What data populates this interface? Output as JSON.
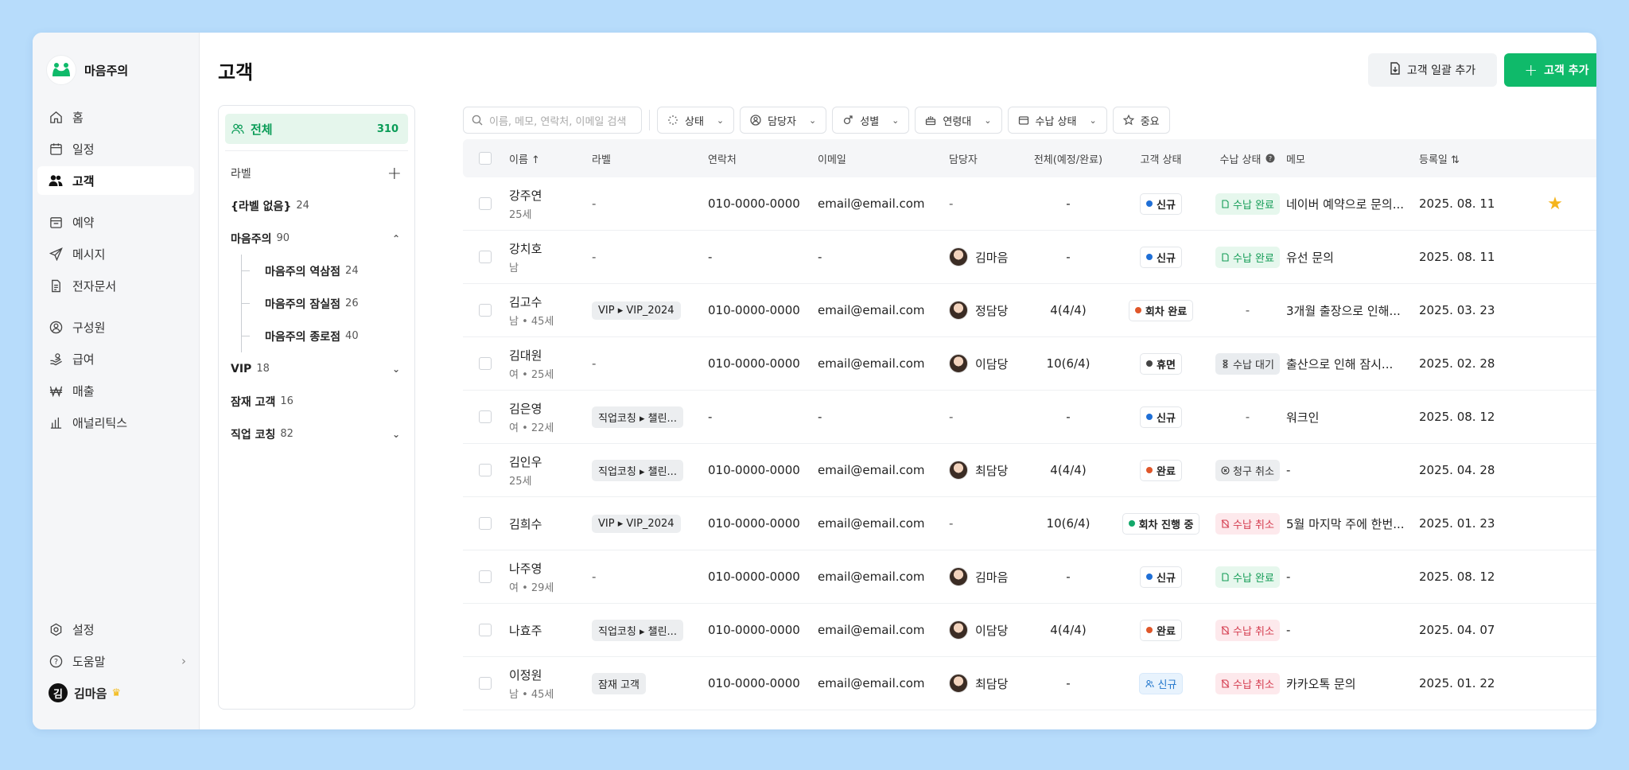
{
  "app": {
    "name": "마음주의"
  },
  "sidebar": {
    "items": [
      {
        "label": "홈",
        "icon": "home-icon"
      },
      {
        "label": "일정",
        "icon": "calendar-icon"
      },
      {
        "label": "고객",
        "icon": "users-icon",
        "active": true
      },
      {
        "label": "예약",
        "icon": "reservation-icon"
      },
      {
        "label": "메시지",
        "icon": "send-icon"
      },
      {
        "label": "전자문서",
        "icon": "document-icon"
      },
      {
        "label": "구성원",
        "icon": "member-icon"
      },
      {
        "label": "급여",
        "icon": "salary-icon"
      },
      {
        "label": "매출",
        "icon": "won-icon"
      },
      {
        "label": "애널리틱스",
        "icon": "chart-icon"
      }
    ],
    "bottom": {
      "settings": "설정",
      "help": "도움말",
      "user": "김마음",
      "user_initial": "김"
    }
  },
  "page": {
    "title": "고객",
    "bulk_add": "고객 일괄 추가",
    "add": "고객 추가"
  },
  "labels": {
    "all": {
      "label": "전체",
      "count": "310"
    },
    "header": "라벨",
    "items": [
      {
        "label": "{라벨 없음}",
        "count": "24"
      },
      {
        "label": "마음주의",
        "count": "90",
        "expanded": true
      },
      {
        "label": "마음주의 역삼점",
        "count": "24",
        "child": true
      },
      {
        "label": "마음주의 잠실점",
        "count": "26",
        "child": true
      },
      {
        "label": "마음주의 종로점",
        "count": "40",
        "child": true
      },
      {
        "label": "VIP",
        "count": "18",
        "collapsed": true
      },
      {
        "label": "잠재 고객",
        "count": "16"
      },
      {
        "label": "직업 코칭",
        "count": "82",
        "collapsed": true
      }
    ]
  },
  "filters": {
    "search_placeholder": "이름, 메모, 연락처, 이메일 검색",
    "chips": [
      "상태",
      "담당자",
      "성별",
      "연령대",
      "수납 상태",
      "중요"
    ]
  },
  "table": {
    "columns": [
      "이름 ↑",
      "라벨",
      "연락처",
      "이메일",
      "담당자",
      "전체(예정/완료)",
      "고객 상태",
      "수납 상태",
      "메모",
      "등록일 ⇅"
    ],
    "rows": [
      {
        "name": "강주연",
        "sub": "25세",
        "label": "",
        "phone": "010-0000-0000",
        "email": "email@email.com",
        "manager": "",
        "total": "-",
        "status": "신규",
        "status_color": "#1f6fd6",
        "pay": "수납 완료",
        "pay_type": "done",
        "memo": "네이버 예약으로 문의...",
        "date": "2025. 08. 11",
        "star": true
      },
      {
        "name": "강치호",
        "sub": "남",
        "label": "",
        "phone": "-",
        "email": "-",
        "manager": "김마음",
        "total": "-",
        "status": "신규",
        "status_color": "#1f6fd6",
        "pay": "수납 완료",
        "pay_type": "done",
        "memo": "유선 문의",
        "date": "2025. 08. 11"
      },
      {
        "name": "김고수",
        "sub": "남 • 45세",
        "label": "VIP ▸ VIP_2024",
        "phone": "010-0000-0000",
        "email": "email@email.com",
        "manager": "정담당",
        "total": "4(4/4)",
        "status": "회차 완료",
        "status_color": "#e0572a",
        "pay": "-",
        "pay_type": "none",
        "memo": "3개월 출장으로 인해...",
        "date": "2025. 03. 23"
      },
      {
        "name": "김대원",
        "sub": "여 • 25세",
        "label": "",
        "phone": "010-0000-0000",
        "email": "email@email.com",
        "manager": "이담당",
        "total": "10(6/4)",
        "status": "휴면",
        "status_color": "#444444",
        "pay": "수납 대기",
        "pay_type": "wait",
        "memo": "출산으로 인해 잠시...",
        "date": "2025. 02. 28"
      },
      {
        "name": "김은영",
        "sub": "여 • 22세",
        "label": "직업코칭 ▸ 챌린...",
        "phone": "-",
        "email": "-",
        "manager": "",
        "total": "-",
        "status": "신규",
        "status_color": "#1f6fd6",
        "pay": "-",
        "pay_type": "none",
        "memo": "워크인",
        "date": "2025. 08. 12"
      },
      {
        "name": "김인우",
        "sub": "25세",
        "label": "직업코칭 ▸ 챌린...",
        "phone": "010-0000-0000",
        "email": "email@email.com",
        "manager": "최담당",
        "total": "4(4/4)",
        "status": "완료",
        "status_color": "#e0572a",
        "pay": "청구 취소",
        "pay_type": "claim",
        "memo": "-",
        "date": "2025. 04. 28"
      },
      {
        "name": "김희수",
        "sub": "",
        "label": "VIP ▸ VIP_2024",
        "phone": "010-0000-0000",
        "email": "email@email.com",
        "manager": "",
        "total": "10(6/4)",
        "status": "회차 진행 중",
        "status_color": "#12a86a",
        "pay": "수납 취소",
        "pay_type": "cancel",
        "memo": "5월 마지막 주에 한번...",
        "date": "2025. 01. 23"
      },
      {
        "name": "나주영",
        "sub": "여 • 29세",
        "label": "",
        "phone": "010-0000-0000",
        "email": "email@email.com",
        "manager": "김마음",
        "total": "-",
        "status": "신규",
        "status_color": "#1f6fd6",
        "pay": "수납 완료",
        "pay_type": "done",
        "memo": "-",
        "date": "2025. 08. 12"
      },
      {
        "name": "나효주",
        "sub": "",
        "label": "직업코칭 ▸ 챌린...",
        "phone": "010-0000-0000",
        "email": "email@email.com",
        "manager": "이담당",
        "total": "4(4/4)",
        "status": "완료",
        "status_color": "#e0572a",
        "pay": "수납 취소",
        "pay_type": "cancel",
        "memo": "-",
        "date": "2025. 04. 07"
      },
      {
        "name": "이정원",
        "sub": "남 • 45세",
        "label": "잠재 고객",
        "phone": "010-0000-0000",
        "email": "email@email.com",
        "manager": "최담당",
        "total": "-",
        "status": "신규",
        "status_color": "#1f6fd6",
        "status_style": "light",
        "pay": "수납 취소",
        "pay_type": "cancel",
        "memo": "카카오톡 문의",
        "date": "2025. 01. 22"
      }
    ]
  },
  "colors": {
    "accent": "#0fba6a",
    "background": "#b7dcfb",
    "sidebar": "#f5f6f8"
  }
}
